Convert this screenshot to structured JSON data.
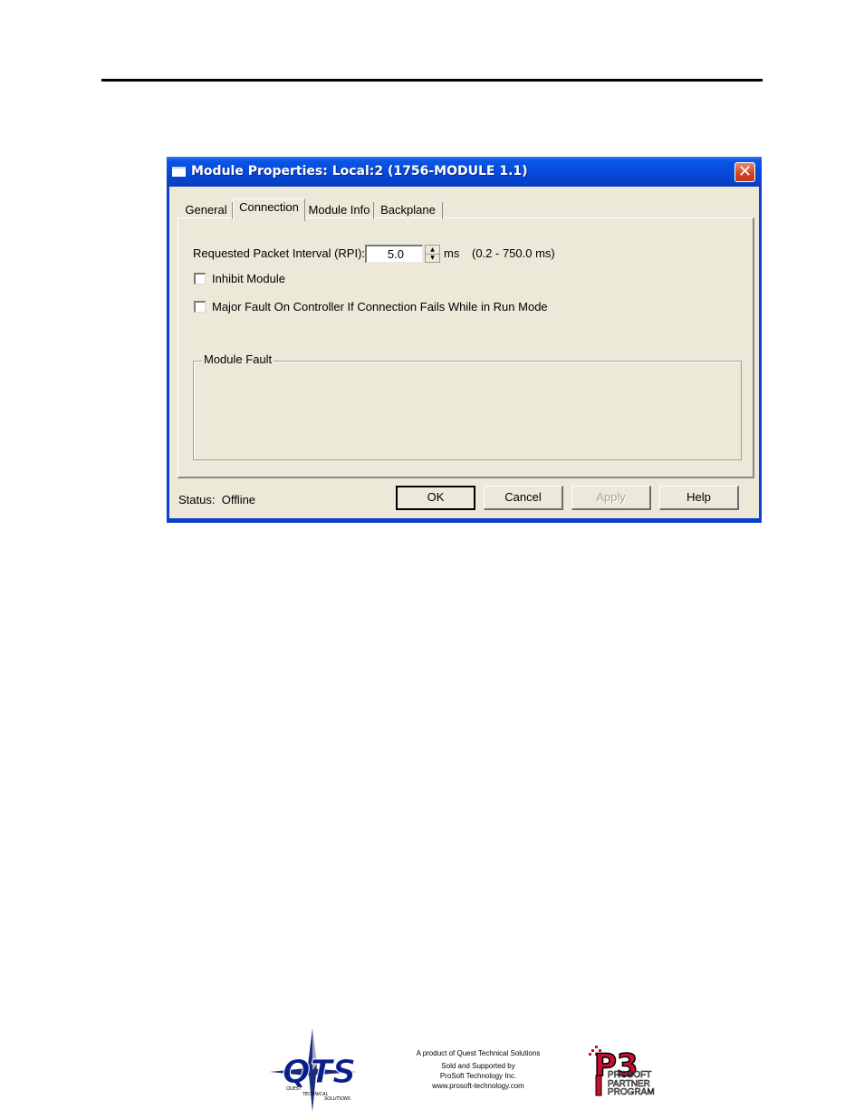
{
  "dialog": {
    "title": "Module Properties: Local:2 (1756-MODULE 1.1)",
    "close_glyph": "✕",
    "tabs": [
      {
        "label": "General"
      },
      {
        "label": "Connection"
      },
      {
        "label": "Module Info"
      },
      {
        "label": "Backplane"
      }
    ],
    "active_tab": "Connection",
    "rpi": {
      "label": "Requested Packet Interval (RPI):",
      "value": "5.0",
      "unit": "ms",
      "range": "(0.2 - 750.0 ms)"
    },
    "inhibit_module": {
      "label": "Inhibit Module",
      "checked": false
    },
    "major_fault": {
      "label": "Major Fault On Controller If Connection Fails While in Run Mode",
      "checked": false
    },
    "module_fault": {
      "legend": "Module Fault"
    },
    "status": {
      "label": "Status:",
      "value": "Offline"
    },
    "buttons": {
      "ok": "OK",
      "cancel": "Cancel",
      "apply": "Apply",
      "help": "Help"
    }
  },
  "footer": {
    "qts_logo_text": "QTS",
    "qts_sub_1": "QUEST",
    "qts_sub_2": "TECHNICAL",
    "qts_sub_3": "SOLUTIONS",
    "line1": "A product of Quest Technical Solutions",
    "line2": "Sold and Supported by",
    "line3": "ProSoft Technology Inc.",
    "line4": "www.prosoft-technology.com",
    "p3_logo_text": "P3",
    "p3_line1": "PROSOFT",
    "p3_line2": "PARTNER",
    "p3_line3": "PROGRAM"
  },
  "colors": {
    "titlebar": "#0a55e6",
    "dialog_face": "#ece9d8",
    "close_button": "#d3441e",
    "qts_logo": "#0b1f8a",
    "p3_logo_red": "#c8102e"
  }
}
